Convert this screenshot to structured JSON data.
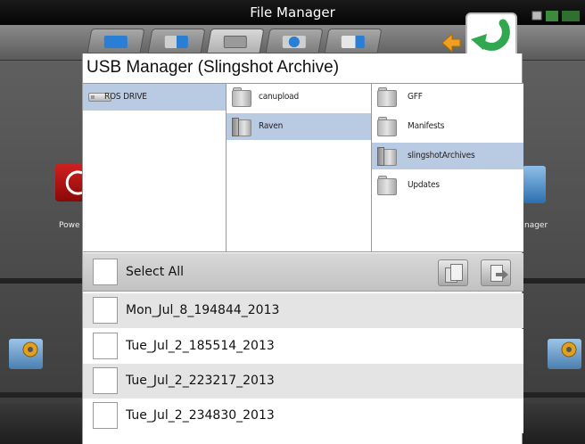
{
  "window": {
    "title": "File Manager"
  },
  "toolbar": {
    "tabs": [
      {
        "icon": "computer-drive-icon",
        "color": "#2a7fd4"
      },
      {
        "icon": "transfer-icon",
        "color": "#2a7fd4"
      },
      {
        "icon": "usb-drive-icon",
        "color": "#d8d8d8",
        "active": true
      },
      {
        "icon": "sync-icon",
        "color": "#2a7fd4"
      },
      {
        "icon": "export-icon",
        "color": "#2a7fd4"
      }
    ],
    "back_icon": "back-arrow-icon",
    "refresh_icon": "refresh-icon"
  },
  "background_apps": {
    "left_label": "Powe",
    "right_label": "nager"
  },
  "dialog": {
    "title": "USB Manager (Slingshot Archive)",
    "columns": [
      {
        "items": [
          {
            "label": "ROS DRIVE",
            "icon": "usb-drive-icon",
            "selected": true
          }
        ]
      },
      {
        "items": [
          {
            "label": "canupload",
            "icon": "folder-icon",
            "selected": false
          },
          {
            "label": "Raven",
            "icon": "open-folder-icon",
            "selected": true
          }
        ]
      },
      {
        "items": [
          {
            "label": "GFF",
            "icon": "folder-icon",
            "selected": false
          },
          {
            "label": "Manifests",
            "icon": "folder-icon",
            "selected": false
          },
          {
            "label": "slingshotArchives",
            "icon": "open-folder-icon",
            "selected": true
          },
          {
            "label": "Updates",
            "icon": "folder-icon",
            "selected": false
          }
        ]
      }
    ],
    "select_all_label": "Select All",
    "files": [
      {
        "name": "Mon_Jul_8_194844_2013",
        "checked": false
      },
      {
        "name": "Tue_Jul_2_185514_2013",
        "checked": false
      },
      {
        "name": "Tue_Jul_2_223217_2013",
        "checked": false
      },
      {
        "name": "Tue_Jul_2_234830_2013",
        "checked": false
      }
    ]
  },
  "colors": {
    "selection": "#b9cbe3",
    "accent_green": "#2fa84f",
    "accent_orange": "#f0a020"
  }
}
